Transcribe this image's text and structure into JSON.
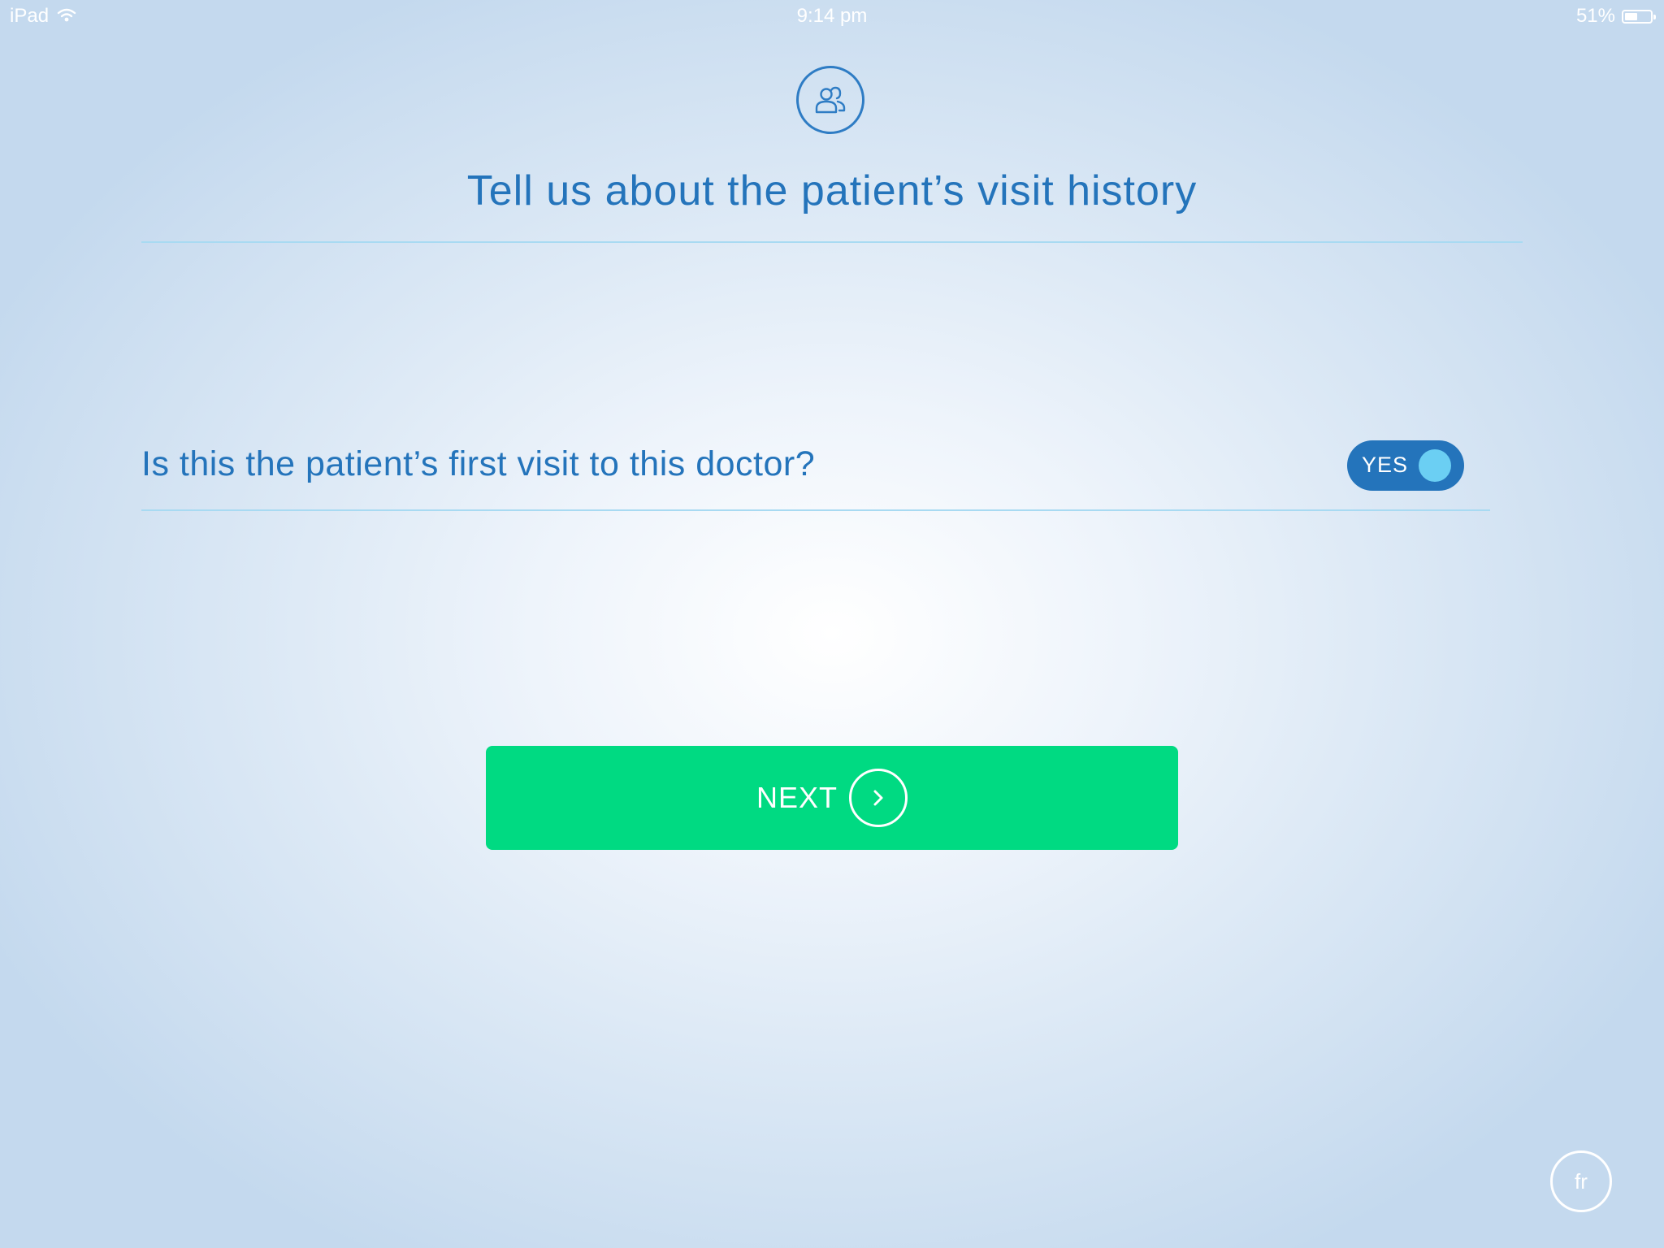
{
  "status_bar": {
    "device": "iPad",
    "time": "9:14 pm",
    "battery_percent_label": "51%",
    "battery_level": 0.51,
    "wifi_icon": "wifi-icon",
    "battery_icon": "battery-icon"
  },
  "header": {
    "icon": "people-icon",
    "title": "Tell us about the patient’s visit history"
  },
  "question": {
    "text": "Is this the patient’s first visit to this doctor?",
    "toggle_label": "YES",
    "toggle_on": true
  },
  "next_button": {
    "label": "NEXT",
    "icon": "chevron-right-icon"
  },
  "language_button": {
    "label": "fr"
  },
  "colors": {
    "accent_blue": "#2474bb",
    "divider": "#a8daf2",
    "next_green": "#00da82",
    "toggle_knob": "#6bcff3"
  }
}
